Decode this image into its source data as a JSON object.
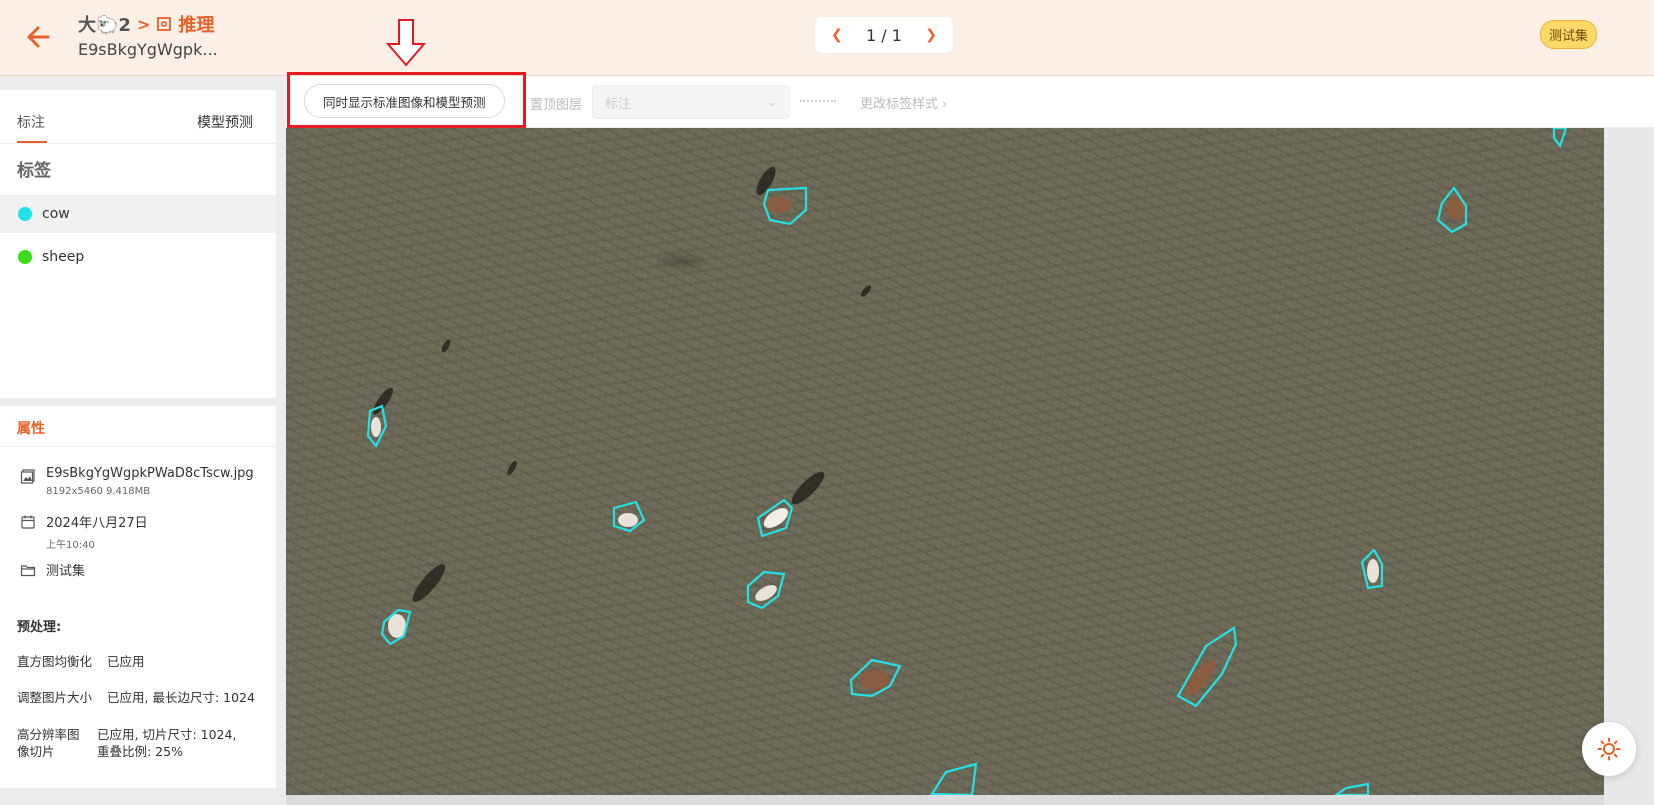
{
  "header": {
    "dataset_name": "大🐑2",
    "crumb_separator": ">",
    "infer_label": "推理",
    "file_title": "E9sBkgYgWgpk...",
    "pager_text": "1 / 1",
    "prev_icon": "chevron-left-icon",
    "next_icon": "chevron-right-icon",
    "split_badge": "测试集",
    "accent_color": "#e8612a"
  },
  "toolbar": {
    "show_both_label": "同时显示标准图像和模型预测",
    "layer_label": "置顶图层",
    "layer_select_value": "标注",
    "label_style_label": "更改标签样式"
  },
  "sidebar": {
    "tabs": [
      {
        "label": "标注",
        "active": true
      },
      {
        "label": "模型预测",
        "active": false
      }
    ],
    "labels_heading": "标签",
    "labels": [
      {
        "name": "cow",
        "color": "#22e2e8"
      },
      {
        "name": "sheep",
        "color": "#3cdc1c"
      }
    ]
  },
  "attributes": {
    "heading": "属性",
    "file_name": "E9sBkgYgWgpkPWaD8cTscw.jpg",
    "file_meta": "8192x5460 9.418MB",
    "date": "2024年八月27日",
    "time": "上午10:40",
    "split": "测试集",
    "preprocessing_title": "预处理:",
    "preprocessing": [
      {
        "key": "直方图均衡化",
        "value": "已应用"
      },
      {
        "key": "调整图片大小",
        "value": "已应用, 最长边尺寸: 1024"
      },
      {
        "key": "高分辨率图像切片",
        "value": "已应用, 切片尺寸: 1024, 重叠比例: 25%"
      }
    ]
  },
  "annotation_color": "#22e2e8",
  "highlight_color": "#e11c25"
}
